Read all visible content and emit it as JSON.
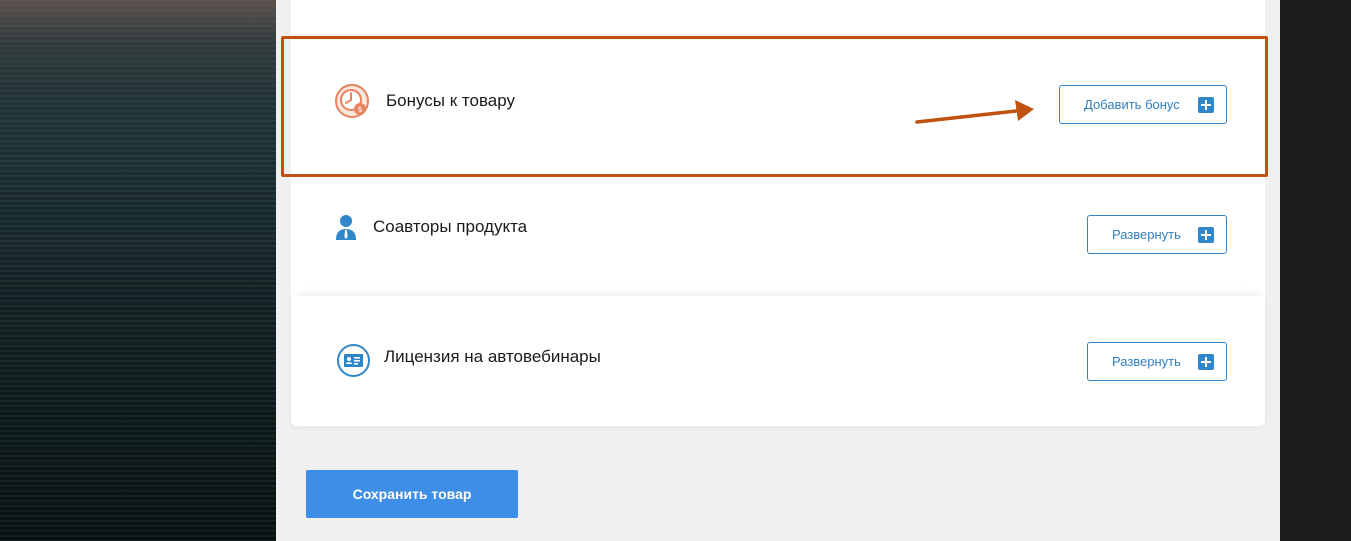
{
  "sections": [
    {
      "title": "Бонусы к товару",
      "button_label": "Добавить бонус",
      "icon": "clock-coin-icon"
    },
    {
      "title": "Соавторы продукта",
      "button_label": "Развернуть",
      "icon": "user-icon"
    },
    {
      "title": "Лицензия на автовебинары",
      "button_label": "Развернуть",
      "icon": "license-icon"
    }
  ],
  "save_button_label": "Сохранить товар",
  "colors": {
    "accent": "#2f86c8",
    "highlight": "#c0520f",
    "save_button": "#3d8ee6",
    "bonus_icon": "#e8825f"
  }
}
